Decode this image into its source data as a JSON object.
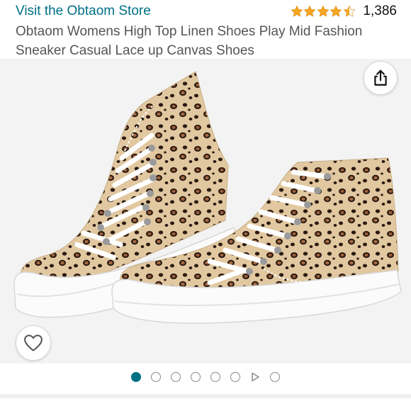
{
  "header": {
    "store_link": "Visit the Obtaom Store",
    "rating_value": 4.5,
    "rating_count": "1,386",
    "star_color": "#f6a623",
    "link_color": "#007185"
  },
  "product": {
    "title": "Obtaom Womens High Top Linen Shoes Play Mid Fashion Sneaker Casual Lace up Canvas Shoes"
  },
  "image": {
    "icons": {
      "share": "share-icon",
      "wishlist": "heart-icon"
    }
  },
  "carousel": {
    "items": [
      "image",
      "image",
      "image",
      "image",
      "image",
      "image",
      "video",
      "image"
    ],
    "active_index": 0
  }
}
